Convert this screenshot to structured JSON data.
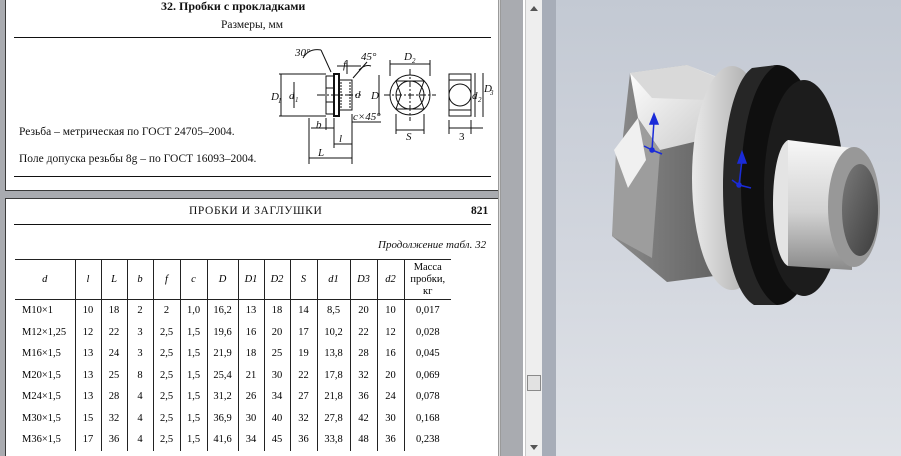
{
  "page_top": {
    "table_title": "32. Пробки с прокладками",
    "sizes_note": "Размеры, мм",
    "thread_note": "Резьба – метрическая по ГОСТ 24705–2004.",
    "tolerance_note": "Поле допуска резьбы 8g – по ГОСТ 16093–2004.",
    "drawing_labels": {
      "angle_30": "30°",
      "f": "f",
      "chamfer_45": "45°",
      "D1": "D",
      "D1_sub": "1",
      "d1": "d",
      "d1_sub": "1",
      "d": "d",
      "b": "b",
      "c45": "c×45°",
      "L": "L",
      "l": "l",
      "D2": "D",
      "D2_sub": "2",
      "D": "D",
      "S": "S",
      "d2": "d",
      "d2_sub": "2",
      "D3": "D",
      "D3_sub": "3",
      "three": "3"
    }
  },
  "page_bottom": {
    "running_head": "ПРОБКИ И ЗАГЛУШКИ",
    "page_number": "821",
    "continuation": "Продолжение табл. 32",
    "table": {
      "columns": [
        "d",
        "l",
        "L",
        "b",
        "f",
        "c",
        "D",
        "D1",
        "D2",
        "S",
        "d1",
        "D3",
        "d2",
        "Масса пробки, кг"
      ],
      "rows": [
        [
          "M10×1",
          "10",
          "18",
          "2",
          "2",
          "1,0",
          "16,2",
          "13",
          "18",
          "14",
          "8,5",
          "20",
          "10",
          "0,017"
        ],
        [
          "M12×1,25",
          "12",
          "22",
          "3",
          "2,5",
          "1,5",
          "19,6",
          "16",
          "20",
          "17",
          "10,2",
          "22",
          "12",
          "0,028"
        ],
        [
          "M16×1,5",
          "13",
          "24",
          "3",
          "2,5",
          "1,5",
          "21,9",
          "18",
          "25",
          "19",
          "13,8",
          "28",
          "16",
          "0,045"
        ],
        [
          "M20×1,5",
          "13",
          "25",
          "8",
          "2,5",
          "1,5",
          "25,4",
          "21",
          "30",
          "22",
          "17,8",
          "32",
          "20",
          "0,069"
        ],
        [
          "M24×1,5",
          "13",
          "28",
          "4",
          "2,5",
          "1,5",
          "31,2",
          "26",
          "34",
          "27",
          "21,8",
          "36",
          "24",
          "0,078"
        ],
        [
          "M30×1,5",
          "15",
          "32",
          "4",
          "2,5",
          "1,5",
          "36,9",
          "30",
          "40",
          "32",
          "27,8",
          "42",
          "30",
          "0,168"
        ],
        [
          "M36×1,5",
          "17",
          "36",
          "4",
          "2,5",
          "1,5",
          "41,6",
          "34",
          "45",
          "36",
          "33,8",
          "48",
          "36",
          "0,238"
        ]
      ]
    }
  },
  "colors": {
    "viewport_bg": "#c9ced7",
    "washer": "#1e1e1e",
    "metal_light": "#f2f2f2",
    "metal_shadow": "#6d6d6d",
    "axis_blue": "#1a2bd8"
  },
  "icons": {
    "scroll_up": "triangle-up",
    "scroll_down": "triangle-down",
    "cad_triad": "xyz-axis-triad"
  }
}
